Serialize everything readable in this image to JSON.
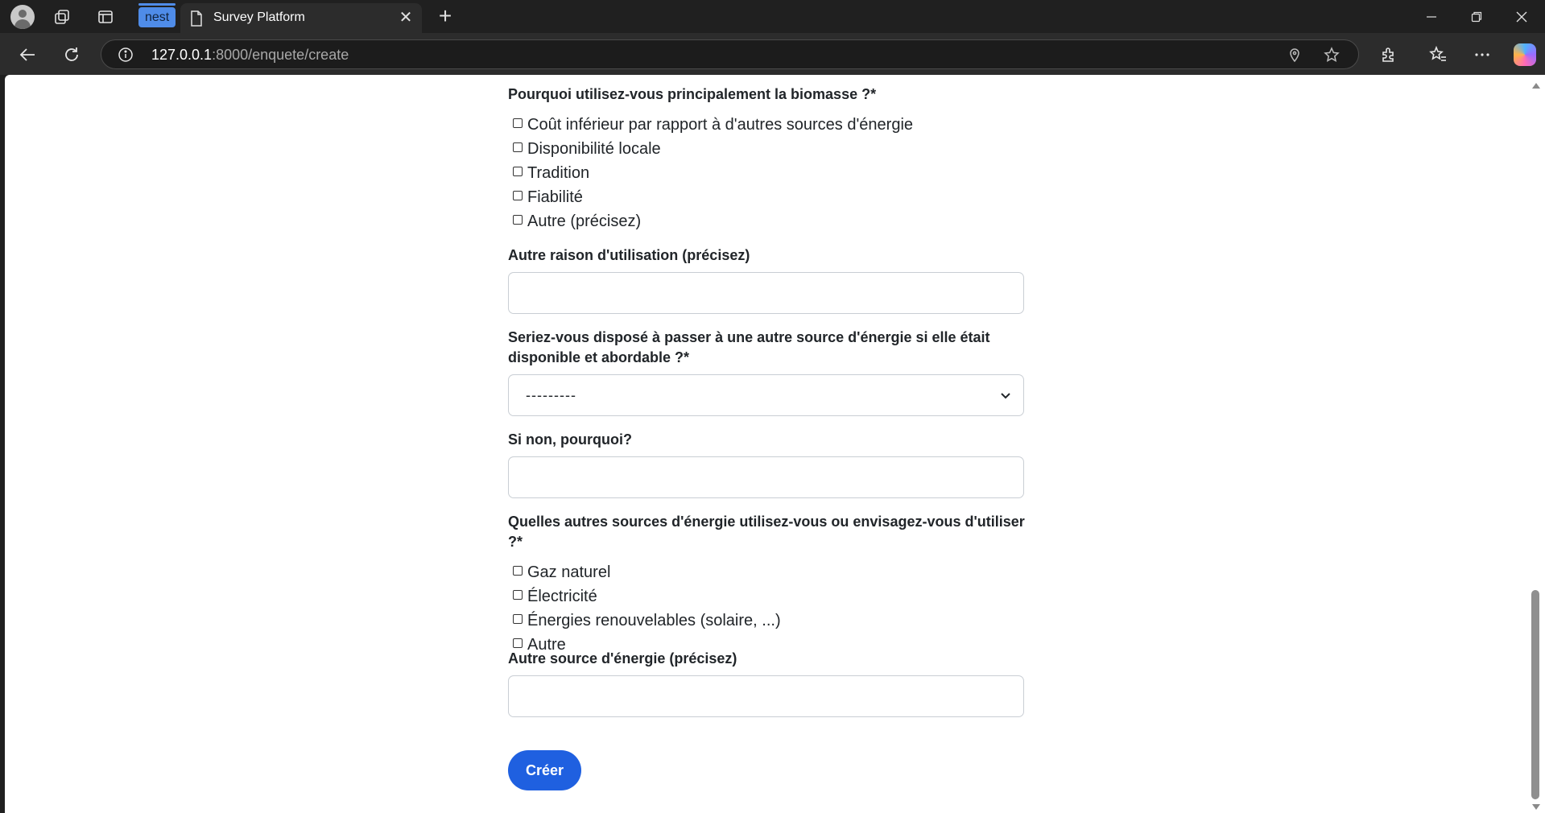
{
  "browser": {
    "tab_group_label": "nest",
    "tab_title": "Survey Platform",
    "url_host": "127.0.0.1",
    "url_rest": ":8000/enquete/create"
  },
  "form": {
    "q1": {
      "label": "Pourquoi utilisez-vous principalement la biomasse ?*",
      "options": [
        "Coût inférieur par rapport à d'autres sources d'énergie",
        "Disponibilité locale",
        "Tradition",
        "Fiabilité",
        "Autre (précisez)"
      ]
    },
    "q2": {
      "label": "Autre raison d'utilisation (précisez)",
      "value": ""
    },
    "q3": {
      "label_line1": "Seriez-vous disposé à passer à une autre source d'énergie si elle était",
      "label_line2": "disponible et abordable ?*",
      "selected": "---------"
    },
    "q4": {
      "label": "Si non, pourquoi?",
      "value": ""
    },
    "q5": {
      "label": "Quelles autres sources d'énergie utilisez-vous ou envisagez-vous d'utiliser ?*",
      "options": [
        "Gaz naturel",
        "Électricité",
        "Énergies renouvelables (solaire, ...)",
        "Autre"
      ]
    },
    "q6": {
      "label": "Autre source d'énergie (précisez)",
      "value": ""
    },
    "submit_label": "Créer"
  },
  "colors": {
    "accent": "#1f60e0",
    "tab_group": "#4f8ce8"
  }
}
